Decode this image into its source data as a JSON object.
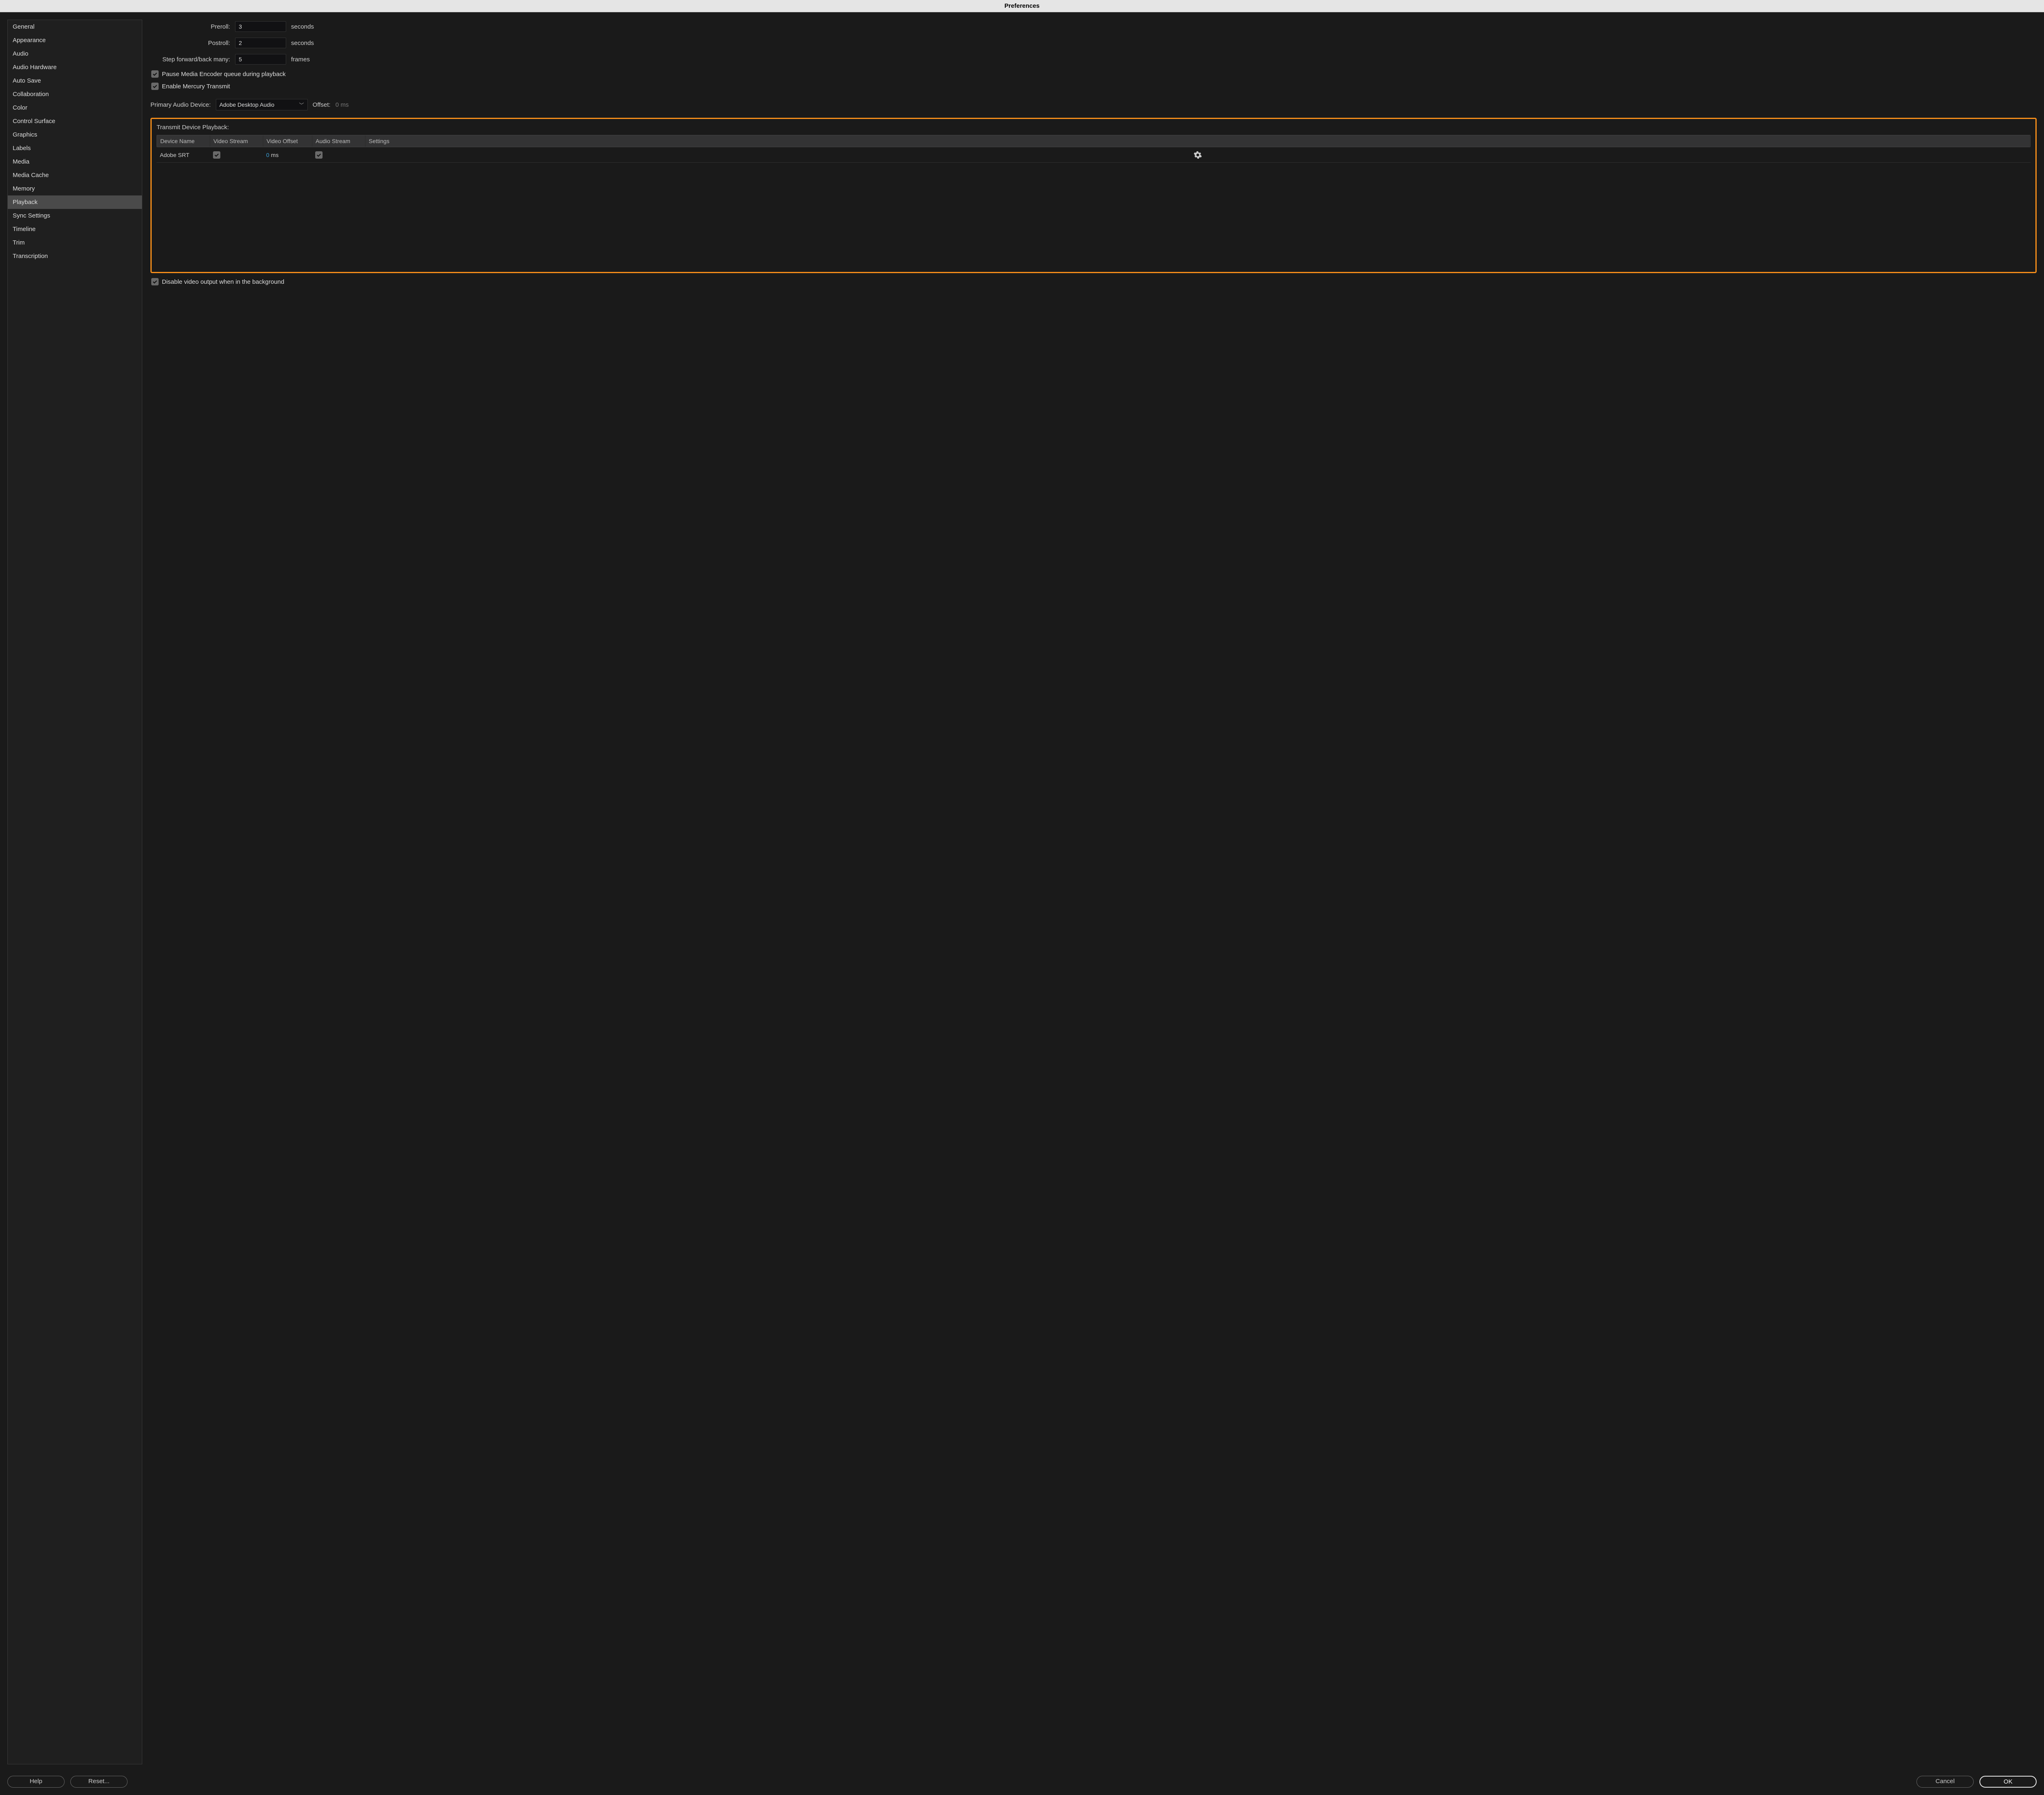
{
  "window": {
    "title": "Preferences"
  },
  "sidebar": {
    "items": [
      {
        "label": "General"
      },
      {
        "label": "Appearance"
      },
      {
        "label": "Audio"
      },
      {
        "label": "Audio Hardware"
      },
      {
        "label": "Auto Save"
      },
      {
        "label": "Collaboration"
      },
      {
        "label": "Color"
      },
      {
        "label": "Control Surface"
      },
      {
        "label": "Graphics"
      },
      {
        "label": "Labels"
      },
      {
        "label": "Media"
      },
      {
        "label": "Media Cache"
      },
      {
        "label": "Memory"
      },
      {
        "label": "Playback"
      },
      {
        "label": "Sync Settings"
      },
      {
        "label": "Timeline"
      },
      {
        "label": "Trim"
      },
      {
        "label": "Transcription"
      }
    ],
    "active_index": 13
  },
  "form": {
    "preroll": {
      "label": "Preroll:",
      "value": "3",
      "unit": "seconds"
    },
    "postroll": {
      "label": "Postroll:",
      "value": "2",
      "unit": "seconds"
    },
    "step": {
      "label": "Step forward/back many:",
      "value": "5",
      "unit": "frames"
    },
    "pause_encoder": {
      "label": "Pause Media Encoder queue during playback",
      "checked": true
    },
    "mercury": {
      "label": "Enable Mercury Transmit",
      "checked": true
    },
    "primary_audio": {
      "label": "Primary Audio Device:",
      "value": "Adobe Desktop Audio"
    },
    "offset": {
      "label": "Offset:",
      "value": "0 ms"
    },
    "transmit_section_title": "Transmit Device Playback:",
    "table": {
      "headers": {
        "device": "Device Name",
        "vstream": "Video Stream",
        "voffset": "Video Offset",
        "astream": "Audio Stream",
        "settings": "Settings"
      },
      "rows": [
        {
          "device": "Adobe SRT",
          "vstream_checked": true,
          "voffset_value": "0",
          "voffset_unit": "ms",
          "astream_checked": true
        }
      ]
    },
    "disable_bg": {
      "label": "Disable video output when in the background",
      "checked": true
    }
  },
  "footer": {
    "help": "Help",
    "reset": "Reset...",
    "cancel": "Cancel",
    "ok": "OK"
  }
}
